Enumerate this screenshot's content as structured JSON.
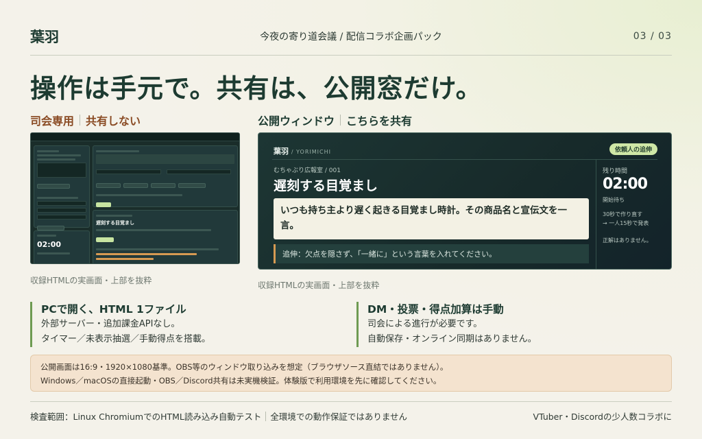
{
  "header": {
    "brand": "葉羽",
    "title": "今夜の寄り道会議 / 配信コラボ企画パック",
    "page": "03 / 03"
  },
  "headline": "操作は手元で。共有は、公開窓だけ。",
  "sections": {
    "host": {
      "label": "司会専用",
      "sub": "共有しない"
    },
    "public": {
      "label": "公開ウィンドウ",
      "sub": "こちらを共有"
    }
  },
  "host_shot": {
    "timer": "02:00",
    "title": "遅刻する目覚まし"
  },
  "public_window": {
    "brand": "葉羽",
    "brand_sub": "/ YORIMICHI",
    "badge": "依頼人の追伸",
    "category": "むちゃぶり広報室 / 001",
    "title": "遅刻する目覚まし",
    "prompt": "いつも持ち主より遅く起きる目覚まし時計。その商品名と宣伝文を一言。",
    "extra": "追伸：欠点を隠さず、「一緒に」という言葉を入れてください。",
    "remaining_label": "残り時間",
    "remaining": "02:00",
    "state": "開始待ち",
    "note1": "30秒で作り直す",
    "note2": "→ 一人15秒で発表",
    "note3": "正解はありません。"
  },
  "captions": {
    "host": "収録HTMLの実画面・上部を抜粋",
    "public": "収録HTMLの実画面・上部を抜粋"
  },
  "features": [
    {
      "title": "PCで開く、HTML 1ファイル",
      "lines": [
        "外部サーバー・追加課金APIなし。",
        "タイマー／未表示抽選／手動得点を搭載。"
      ]
    },
    {
      "title": "DM・投票・得点加算は手動",
      "lines": [
        "司会による進行が必要です。",
        "自動保存・オンライン同期はありません。"
      ]
    }
  ],
  "notice": [
    "公開画面は16:9・1920×1080基準。OBS等のウィンドウ取り込みを想定（ブラウザソース直結ではありません）。",
    "Windows／macOSの直接起動・OBS／Discord共有は未実機検証。体験版で利用環境を先に確認してください。"
  ],
  "footer": {
    "left_a": "検査範囲：Linux ChromiumでのHTML読み込み自動テスト",
    "left_b": "全環境での動作保証ではありません",
    "right": "VTuber・Discordの少人数コラボに"
  },
  "colors": {
    "brand": "#1d3b31",
    "accent_orange": "#8a4b24",
    "accent_green": "#6e9b52",
    "badge": "#cfe7a6",
    "notice_bg": "#f4e3cf"
  }
}
